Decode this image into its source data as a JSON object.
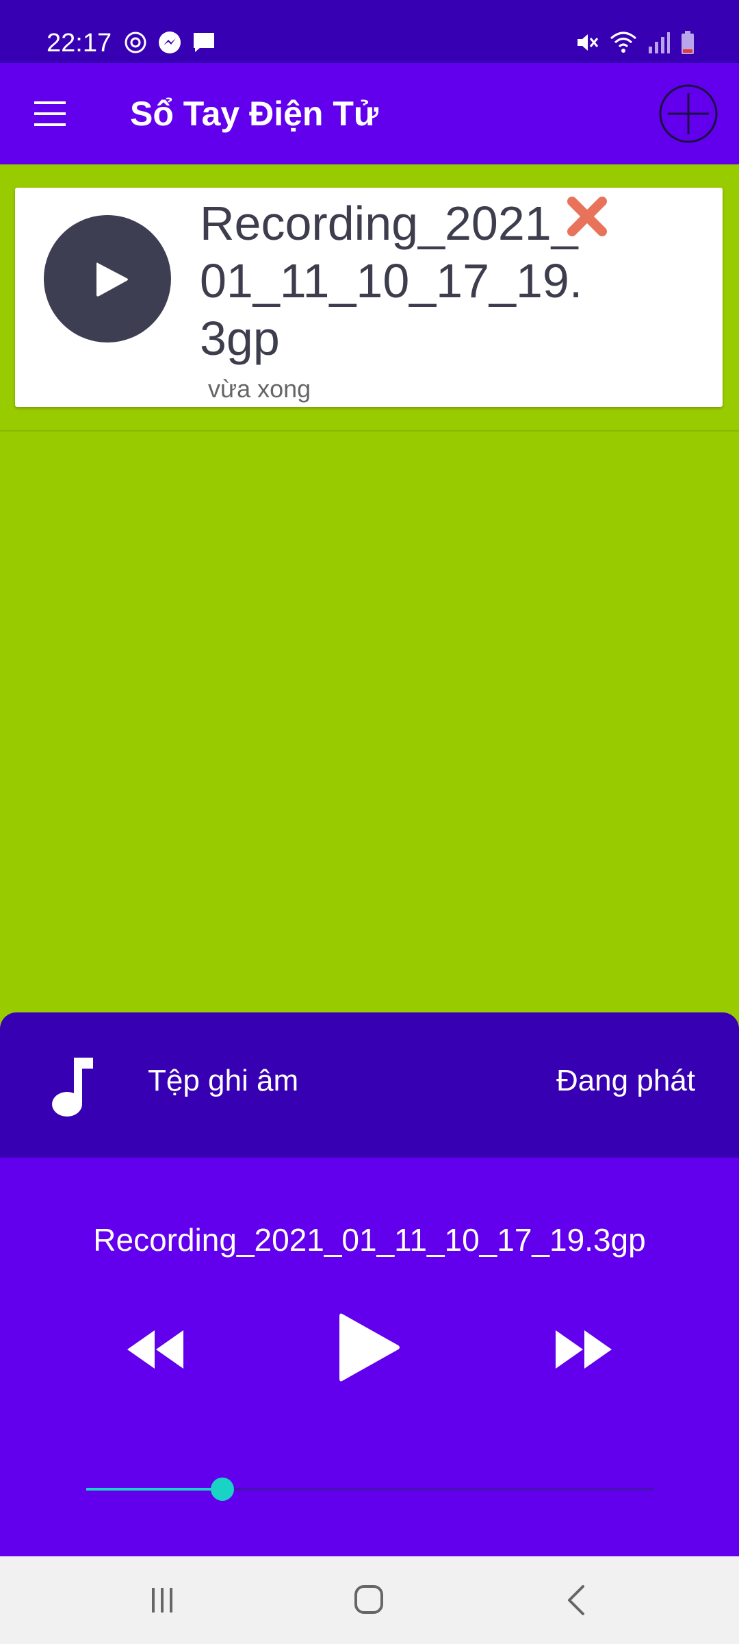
{
  "status_bar": {
    "time": "22:17",
    "left_icons": [
      "sync-icon",
      "messenger-icon",
      "message-icon"
    ],
    "right_icons": [
      "mute-icon",
      "wifi-icon",
      "signal-icon",
      "battery-low-icon"
    ]
  },
  "app_bar": {
    "title": "Sổ Tay Điện Tử",
    "menu_icon": "hamburger-menu-icon",
    "add_icon": "add-circle-icon"
  },
  "recordings": [
    {
      "title": "Recording_2021_01_11_10_17_19.3gp",
      "time": "vừa xong",
      "play_icon": "play-icon",
      "delete_icon": "close-icon"
    }
  ],
  "player": {
    "file_label": "Tệp ghi âm",
    "status": "Đang phát",
    "now_playing": "Recording_2021_01_11_10_17_19.3gp",
    "progress_fraction": 0.24,
    "colors": {
      "header": "#3700b3",
      "body": "#6200ee",
      "accent": "#19d3c5"
    }
  },
  "nav_bar": {
    "icons": [
      "recent-apps-icon",
      "home-icon",
      "back-icon"
    ]
  },
  "colors": {
    "background": "#99cc00",
    "primary": "#6200ee",
    "primary_dark": "#3700b3",
    "delete": "#e8735a"
  }
}
